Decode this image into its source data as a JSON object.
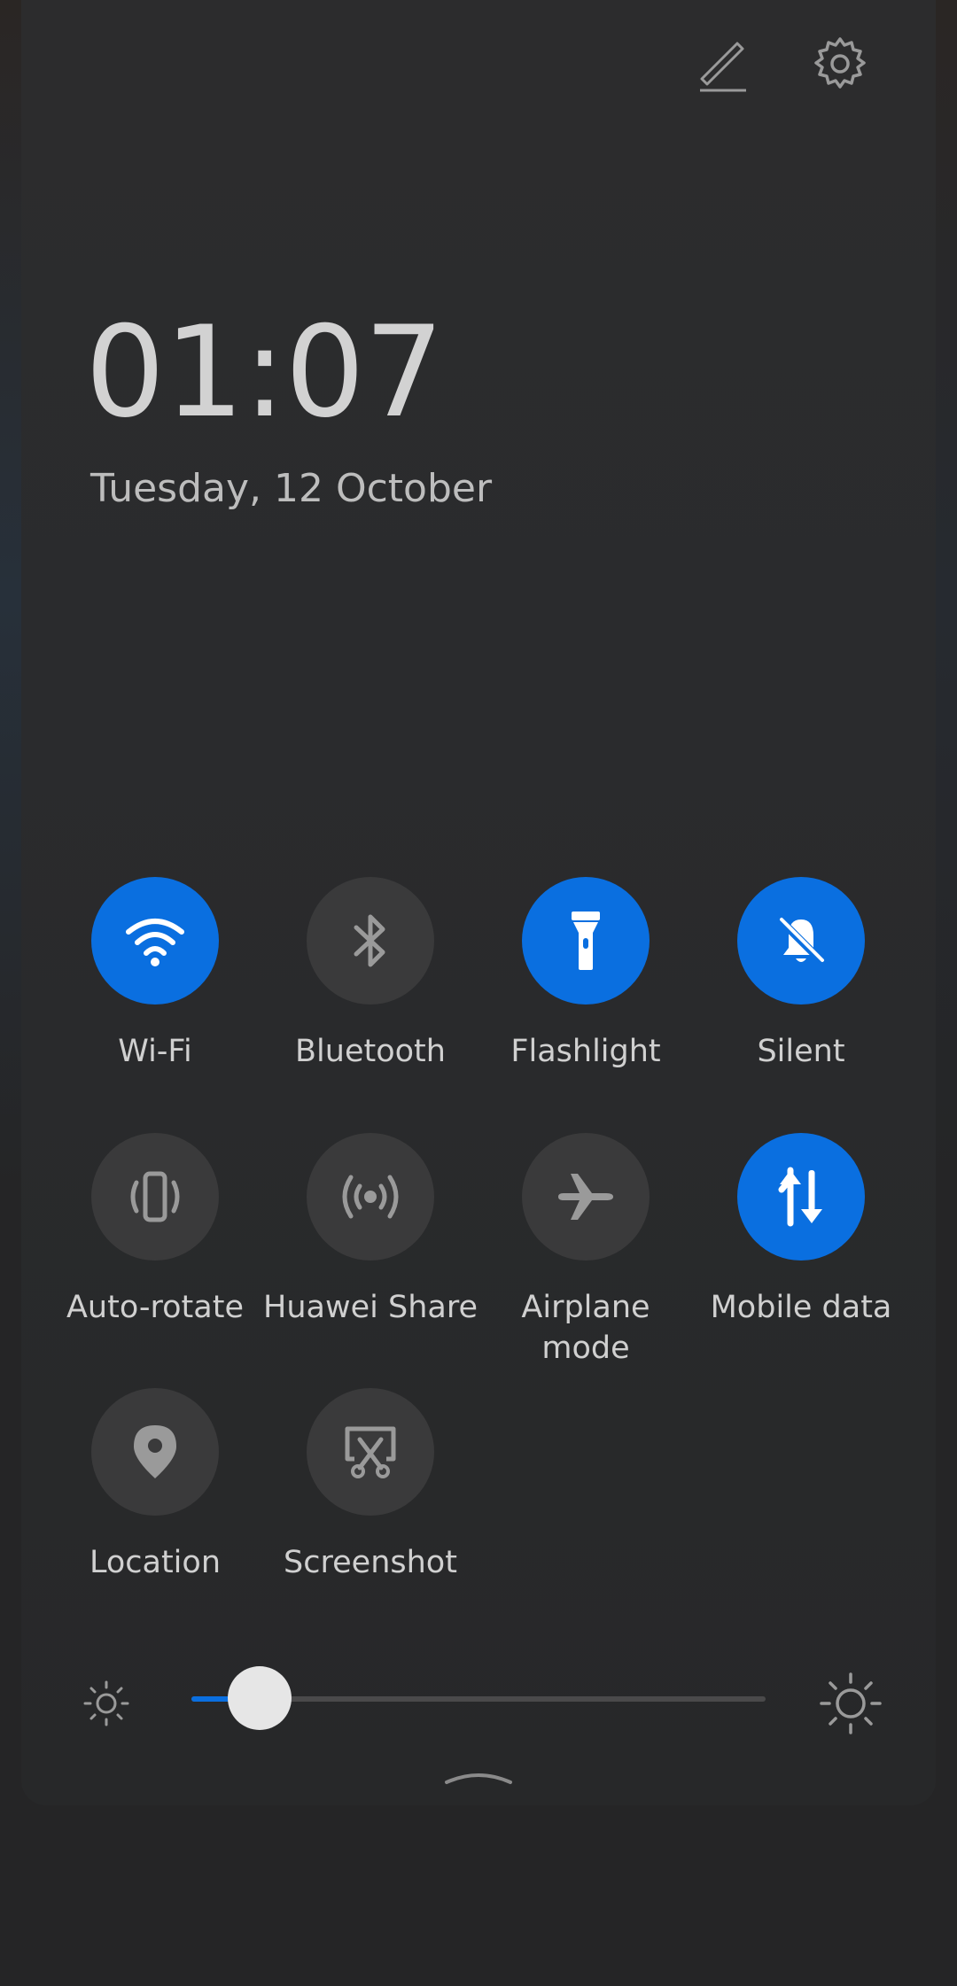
{
  "colors": {
    "accent": "#0a6fe0",
    "tile_off": "#3a3a3b",
    "text": "#d0d0d0"
  },
  "top_bar": {
    "edit_icon": "pencil-icon",
    "settings_icon": "gear-icon"
  },
  "clock": {
    "time": "01:07",
    "date": "Tuesday, 12 October"
  },
  "tiles": [
    {
      "label": "Wi-Fi",
      "icon": "wifi-icon",
      "active": true
    },
    {
      "label": "Bluetooth",
      "icon": "bluetooth-icon",
      "active": false
    },
    {
      "label": "Flashlight",
      "icon": "flashlight-icon",
      "active": true
    },
    {
      "label": "Silent",
      "icon": "bell-off-icon",
      "active": true
    },
    {
      "label": "Auto-rotate",
      "icon": "auto-rotate-icon",
      "active": false
    },
    {
      "label": "Huawei Share",
      "icon": "share-signal-icon",
      "active": false
    },
    {
      "label": "Airplane\nmode",
      "icon": "airplane-icon",
      "active": false
    },
    {
      "label": "Mobile data",
      "icon": "mobile-data-icon",
      "active": true
    },
    {
      "label": "Location",
      "icon": "location-pin-icon",
      "active": false
    },
    {
      "label": "Screenshot",
      "icon": "screenshot-icon",
      "active": false
    }
  ],
  "brightness": {
    "level": 0.1,
    "min_icon": "sun-small-icon",
    "max_icon": "sun-large-icon"
  },
  "collapse_icon": "chevron-up-icon"
}
